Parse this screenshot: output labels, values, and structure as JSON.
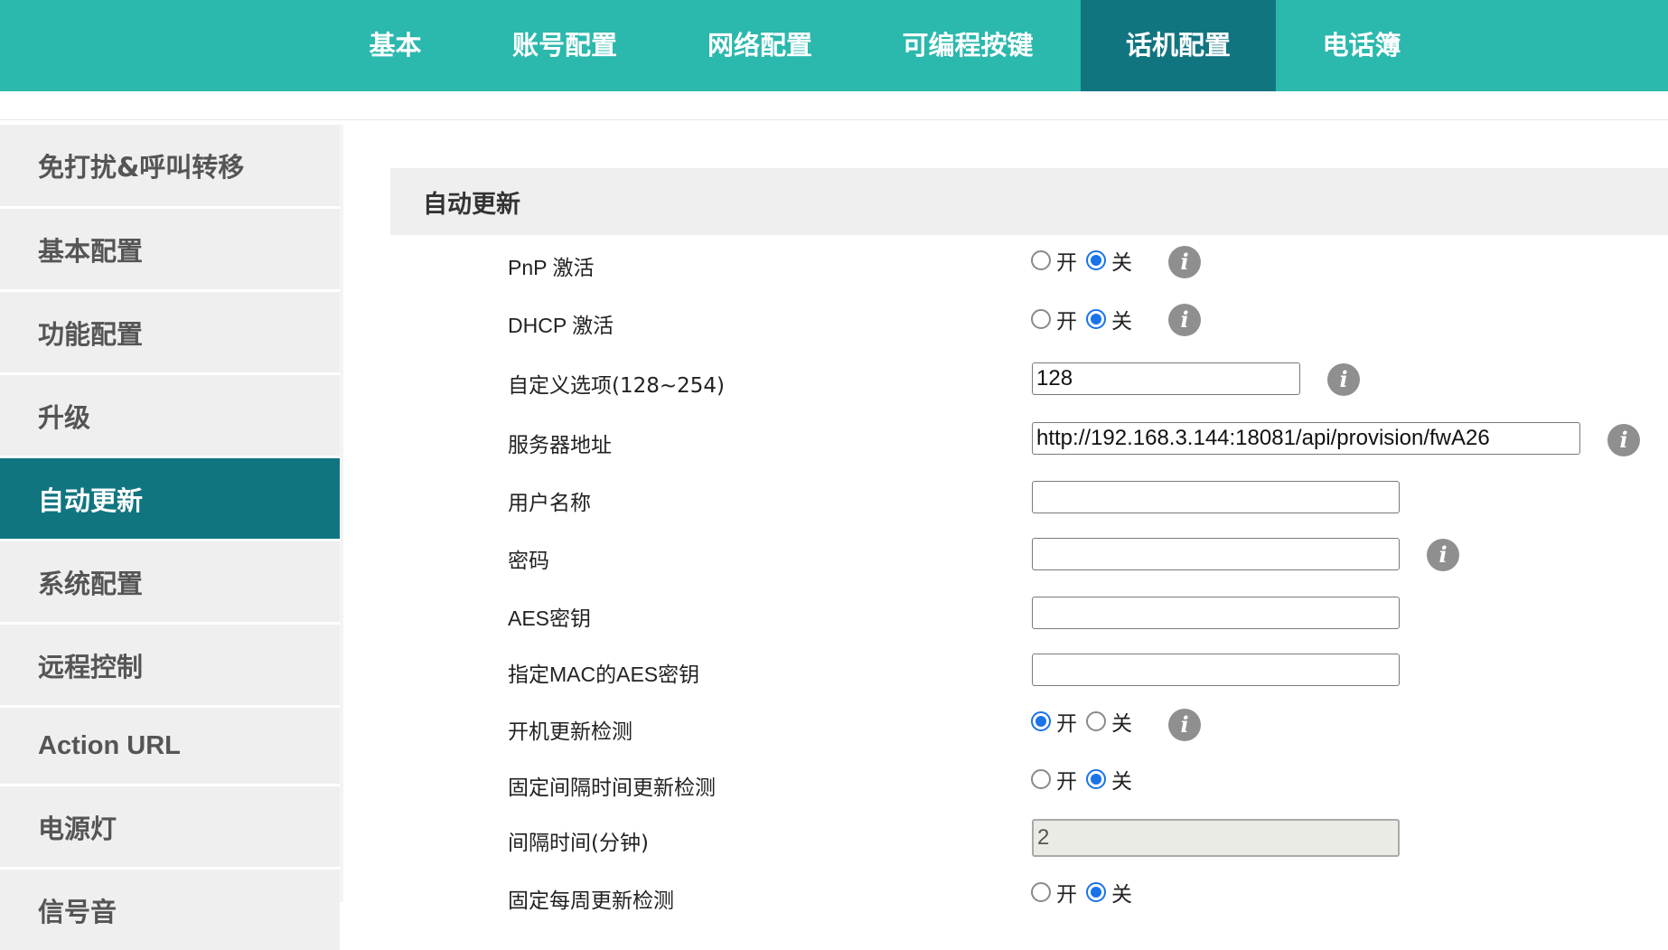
{
  "topnav": {
    "tabs": [
      {
        "label": "基本"
      },
      {
        "label": "账号配置"
      },
      {
        "label": "网络配置"
      },
      {
        "label": "可编程按键"
      },
      {
        "label": "话机配置"
      },
      {
        "label": "电话簿"
      }
    ],
    "active_tab": "话机配置"
  },
  "sidebar": {
    "items": [
      {
        "label": "免打扰&呼叫转移"
      },
      {
        "label": "基本配置"
      },
      {
        "label": "功能配置"
      },
      {
        "label": "升级"
      },
      {
        "label": "自动更新"
      },
      {
        "label": "系统配置"
      },
      {
        "label": "远程控制"
      },
      {
        "label": "Action URL"
      },
      {
        "label": "电源灯"
      },
      {
        "label": "信号音"
      }
    ],
    "active_item": "自动更新"
  },
  "section": {
    "title": "自动更新"
  },
  "radio_text": {
    "on": "开",
    "off": "关"
  },
  "info_glyph": "i",
  "settings": {
    "pnp": {
      "label": "PnP 激活",
      "value": "关"
    },
    "dhcp": {
      "label": "DHCP 激活",
      "value": "关"
    },
    "custom_option": {
      "label": "自定义选项(128~254)",
      "value": "128"
    },
    "server_address": {
      "label": "服务器地址",
      "value": "http://192.168.3.144:18081/api/provision/fwA26"
    },
    "username": {
      "label": "用户名称",
      "value": ""
    },
    "password": {
      "label": "密码",
      "value": ""
    },
    "aes_key": {
      "label": "AES密钥",
      "value": ""
    },
    "mac_aes_key": {
      "label": "指定MAC的AES密钥",
      "value": ""
    },
    "boot_check": {
      "label": "开机更新检测",
      "value": "开"
    },
    "interval_check": {
      "label": "固定间隔时间更新检测",
      "value": "关"
    },
    "interval_minutes": {
      "label": "间隔时间(分钟)",
      "value": "2"
    },
    "weekly_check": {
      "label": "固定每周更新检测",
      "value": "关"
    }
  },
  "colors": {
    "nav_bg": "#2bb8ad",
    "nav_active": "#117580",
    "sidebar_bg": "#efefef",
    "sidebar_active": "#117580",
    "radio_checked": "#1a73e8",
    "info_icon": "#8f8f8f"
  },
  "icons": [
    "info-icon"
  ]
}
